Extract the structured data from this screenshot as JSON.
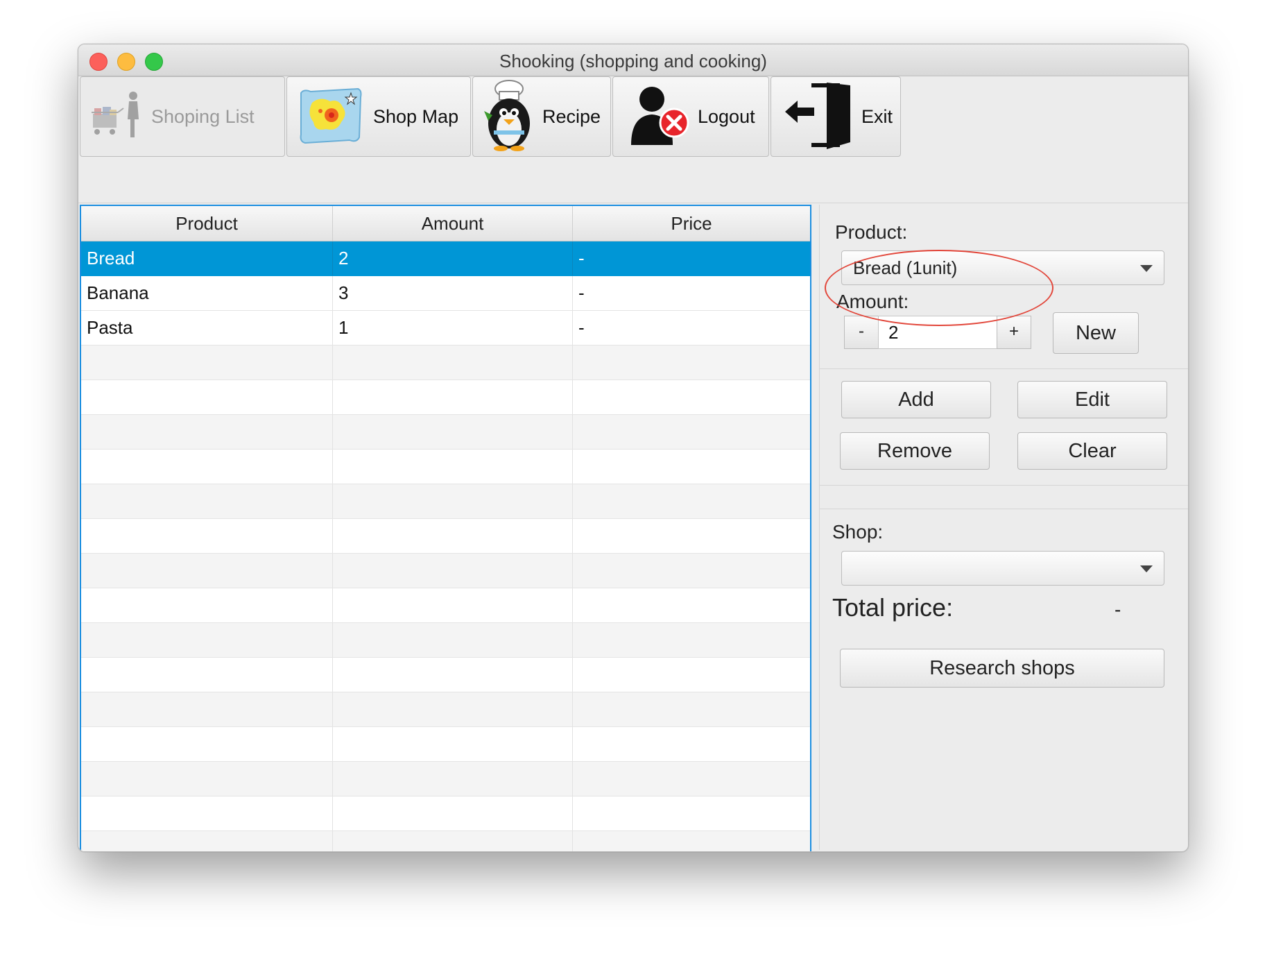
{
  "window": {
    "title": "Shooking (shopping and cooking)"
  },
  "toolbar": {
    "buttons": [
      {
        "label": "Shoping List",
        "icon": "shopping-cart-person-icon",
        "enabled": false
      },
      {
        "label": "Shop Map",
        "icon": "map-icon",
        "enabled": true
      },
      {
        "label": "Recipe",
        "icon": "chef-penguin-icon",
        "enabled": true
      },
      {
        "label": "Logout",
        "icon": "user-logout-icon",
        "enabled": true
      },
      {
        "label": "Exit",
        "icon": "exit-door-icon",
        "enabled": true
      }
    ]
  },
  "table": {
    "columns": [
      "Product",
      "Amount",
      "Price"
    ],
    "rows": [
      {
        "product": "Bread",
        "amount": "2",
        "price": "-",
        "selected": true
      },
      {
        "product": "Banana",
        "amount": "3",
        "price": "-",
        "selected": false
      },
      {
        "product": "Pasta",
        "amount": "1",
        "price": "-",
        "selected": false
      }
    ]
  },
  "form": {
    "product_label": "Product:",
    "product_value": "Bread (1unit)",
    "amount_label": "Amount:",
    "amount_value": "2",
    "minus_label": "-",
    "plus_label": "+",
    "new_label": "New",
    "add_label": "Add",
    "edit_label": "Edit",
    "remove_label": "Remove",
    "clear_label": "Clear",
    "shop_label": "Shop:",
    "shop_value": "",
    "total_label": "Total price:",
    "total_value": "-",
    "research_label": "Research shops"
  },
  "colors": {
    "selection": "#0096d6",
    "table_border": "#1b8ee0",
    "highlight_ellipse": "#e2463a"
  }
}
